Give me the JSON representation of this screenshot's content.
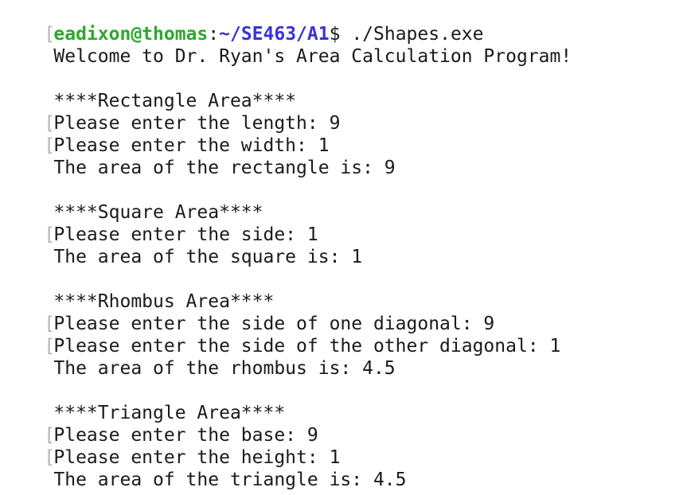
{
  "prompt": {
    "user_host": "eadixon@thomas",
    "separator": ":",
    "path": "~/SE463/A1",
    "symbol": "$",
    "command": " ./Shapes.exe"
  },
  "output": {
    "welcome": "Welcome to Dr. Ryan's Area Calculation Program!",
    "rectangle_header": "****Rectangle Area****",
    "rectangle_length": "Please enter the length: 9",
    "rectangle_width": "Please enter the width: 1",
    "rectangle_result": "The area of the rectangle is: 9",
    "square_header": "****Square Area****",
    "square_side": "Please enter the side: 1",
    "square_result": "The area of the square is: 1",
    "rhombus_header": "****Rhombus Area****",
    "rhombus_diag1": "Please enter the side of one diagonal: 9",
    "rhombus_diag2": "Please enter the side of the other diagonal: 1",
    "rhombus_result": "The area of the rhombus is: 4.5",
    "triangle_header": "****Triangle Area****",
    "triangle_base": "Please enter the base: 9",
    "triangle_height": "Please enter the height: 1",
    "triangle_result": "The area of the triangle is: 4.5"
  },
  "gutter_mark": "["
}
